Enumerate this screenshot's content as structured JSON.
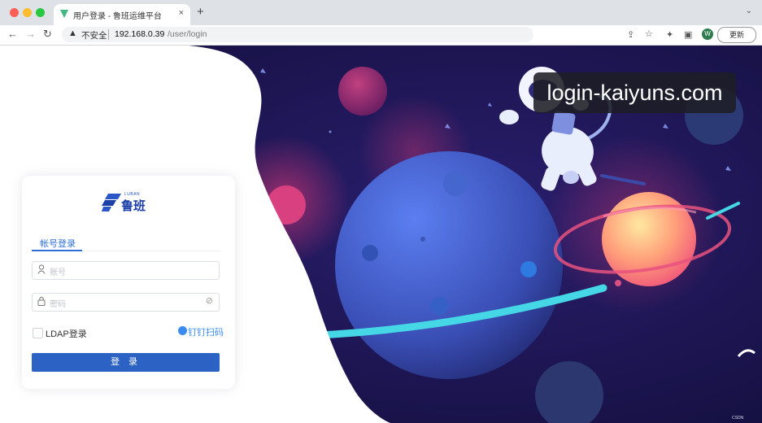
{
  "browser": {
    "tab_title": "用户登录 - 鲁班运维平台",
    "tab_close": "×",
    "new_tab": "+",
    "tab_menu": "⌄",
    "security_label": "不安全",
    "url_host": "192.168.0.39",
    "url_path": "/user/login",
    "update_button": "更新",
    "profile_letter": "W"
  },
  "watermark": "login-kaiyuns.com",
  "login": {
    "logo_en": "LUBAN",
    "logo_cn": "鲁班",
    "tab_account": "帐号登录",
    "username_placeholder": "账号",
    "password_placeholder": "密码",
    "ldap_label": "LDAP登录",
    "dingtalk_label": "钉钉扫码",
    "submit_label": "登 录"
  },
  "colors": {
    "primary": "#2b62c4",
    "link": "#2f6fd6",
    "space_bg": "#1c1550"
  },
  "icons": [
    "vue-icon",
    "warning-icon",
    "user-icon",
    "lock-icon",
    "eye-off-icon",
    "dingtalk-icon",
    "astronaut-illustration",
    "planet-illustration"
  ]
}
